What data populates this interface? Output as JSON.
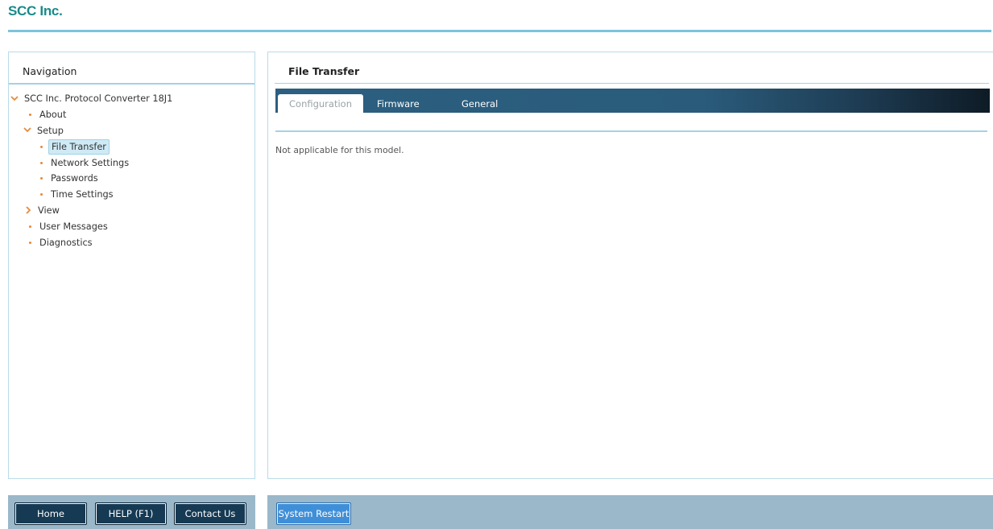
{
  "header": {
    "logo_text": "SCC Inc."
  },
  "navigation": {
    "title": "Navigation",
    "tree": [
      {
        "label": "SCC Inc. Protocol Converter 18J1",
        "type": "expanded",
        "level": 0
      },
      {
        "label": "About",
        "type": "leaf",
        "level": 1
      },
      {
        "label": "Setup",
        "type": "expanded",
        "level": 1
      },
      {
        "label": "File Transfer",
        "type": "leaf",
        "level": 2,
        "selected": true
      },
      {
        "label": "Network Settings",
        "type": "leaf",
        "level": 2
      },
      {
        "label": "Passwords",
        "type": "leaf",
        "level": 2
      },
      {
        "label": "Time Settings",
        "type": "leaf",
        "level": 2
      },
      {
        "label": "View",
        "type": "collapsed",
        "level": 1
      },
      {
        "label": "User Messages",
        "type": "leaf",
        "level": 1
      },
      {
        "label": "Diagnostics",
        "type": "leaf",
        "level": 1
      }
    ]
  },
  "content": {
    "title": "File Transfer",
    "tabs": [
      {
        "label": "Configuration",
        "active": true
      },
      {
        "label": "Firmware",
        "active": false
      },
      {
        "label": "General",
        "active": false
      }
    ],
    "notice": "Not applicable for this model."
  },
  "footer": {
    "home_label": "Home",
    "help_label": "HELP (F1)",
    "contact_label": "Contact Us",
    "restart_label": "System Restart"
  },
  "colors": {
    "brand": "#1a8a8a",
    "accent_line": "#7cc4db",
    "tab_bar": "#2c5f80",
    "bullet": "#e58a3c",
    "footer_bg": "#9ab8c9",
    "restart_button": "#3f8fd8"
  }
}
